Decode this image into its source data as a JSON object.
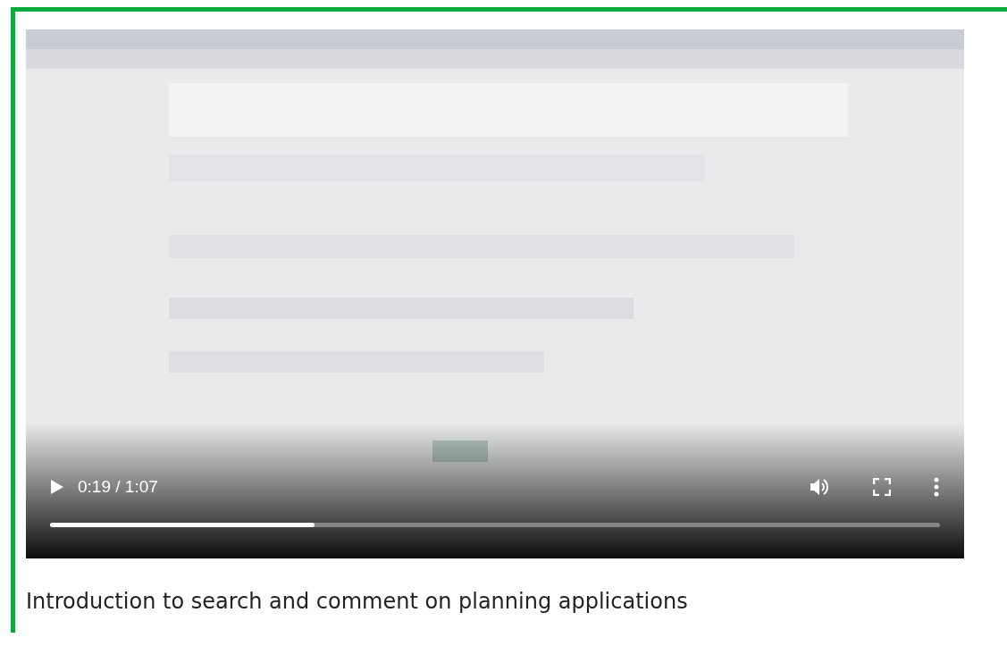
{
  "video": {
    "kind": "picture",
    "playing": false,
    "time": "0:19 / 1:07",
    "progress": {
      "level": 0.297
    }
  },
  "caption": "Introduction to search and comment on planning applications"
}
